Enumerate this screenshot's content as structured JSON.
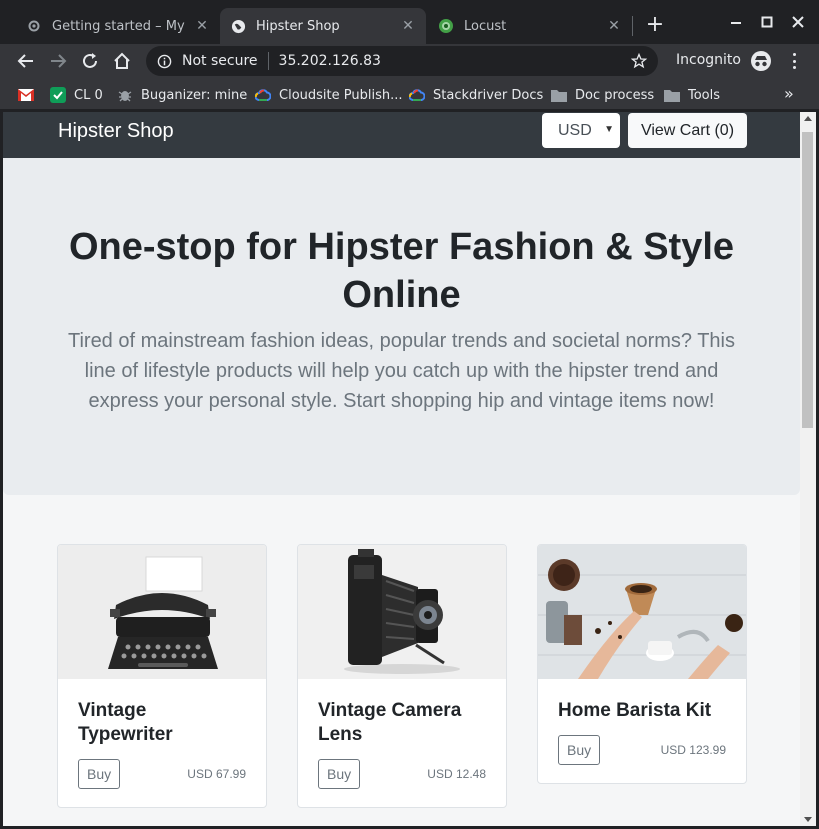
{
  "browser": {
    "tabs": [
      {
        "title": "Getting started – My Fir",
        "icon": "gear-icon",
        "active": false
      },
      {
        "title": "Hipster Shop",
        "icon": "globe-icon",
        "active": true
      },
      {
        "title": "Locust",
        "icon": "locust-icon",
        "active": false
      }
    ],
    "address": {
      "security_label": "Not secure",
      "url": "35.202.126.83"
    },
    "profile_label": "Incognito",
    "bookmarks": [
      {
        "label": "",
        "icon": "gmail-icon"
      },
      {
        "label": "CL 0",
        "icon": "checkmark-icon"
      },
      {
        "label": "Buganizer: mine",
        "icon": "bug-icon"
      },
      {
        "label": "Cloudsite Publish...",
        "icon": "cloud-icon"
      },
      {
        "label": "Stackdriver Docs",
        "icon": "cloud-icon"
      },
      {
        "label": "Doc process",
        "icon": "folder-icon"
      },
      {
        "label": "Tools",
        "icon": "folder-icon"
      }
    ],
    "bookmarks_overflow": "»"
  },
  "page": {
    "brand": "Hipster Shop",
    "currency": "USD",
    "view_cart": "View Cart (0)",
    "hero_title": "One-stop for Hipster Fashion & Style Online",
    "hero_text": "Tired of mainstream fashion ideas, popular trends and societal norms? This line of lifestyle products will help you catch up with the hipster trend and express your personal style. Start shopping hip and vintage items now!",
    "products": [
      {
        "name": "Vintage Typewriter",
        "buy": "Buy",
        "price": "USD 67.99"
      },
      {
        "name": "Vintage Camera Lens",
        "buy": "Buy",
        "price": "USD 12.48"
      },
      {
        "name": "Home Barista Kit",
        "buy": "Buy",
        "price": "USD 123.99"
      }
    ]
  },
  "colors": {
    "chrome_dark": "#202124",
    "toolbar": "#35363a",
    "navbar": "#343a40",
    "hero_bg": "#e9ecef"
  }
}
